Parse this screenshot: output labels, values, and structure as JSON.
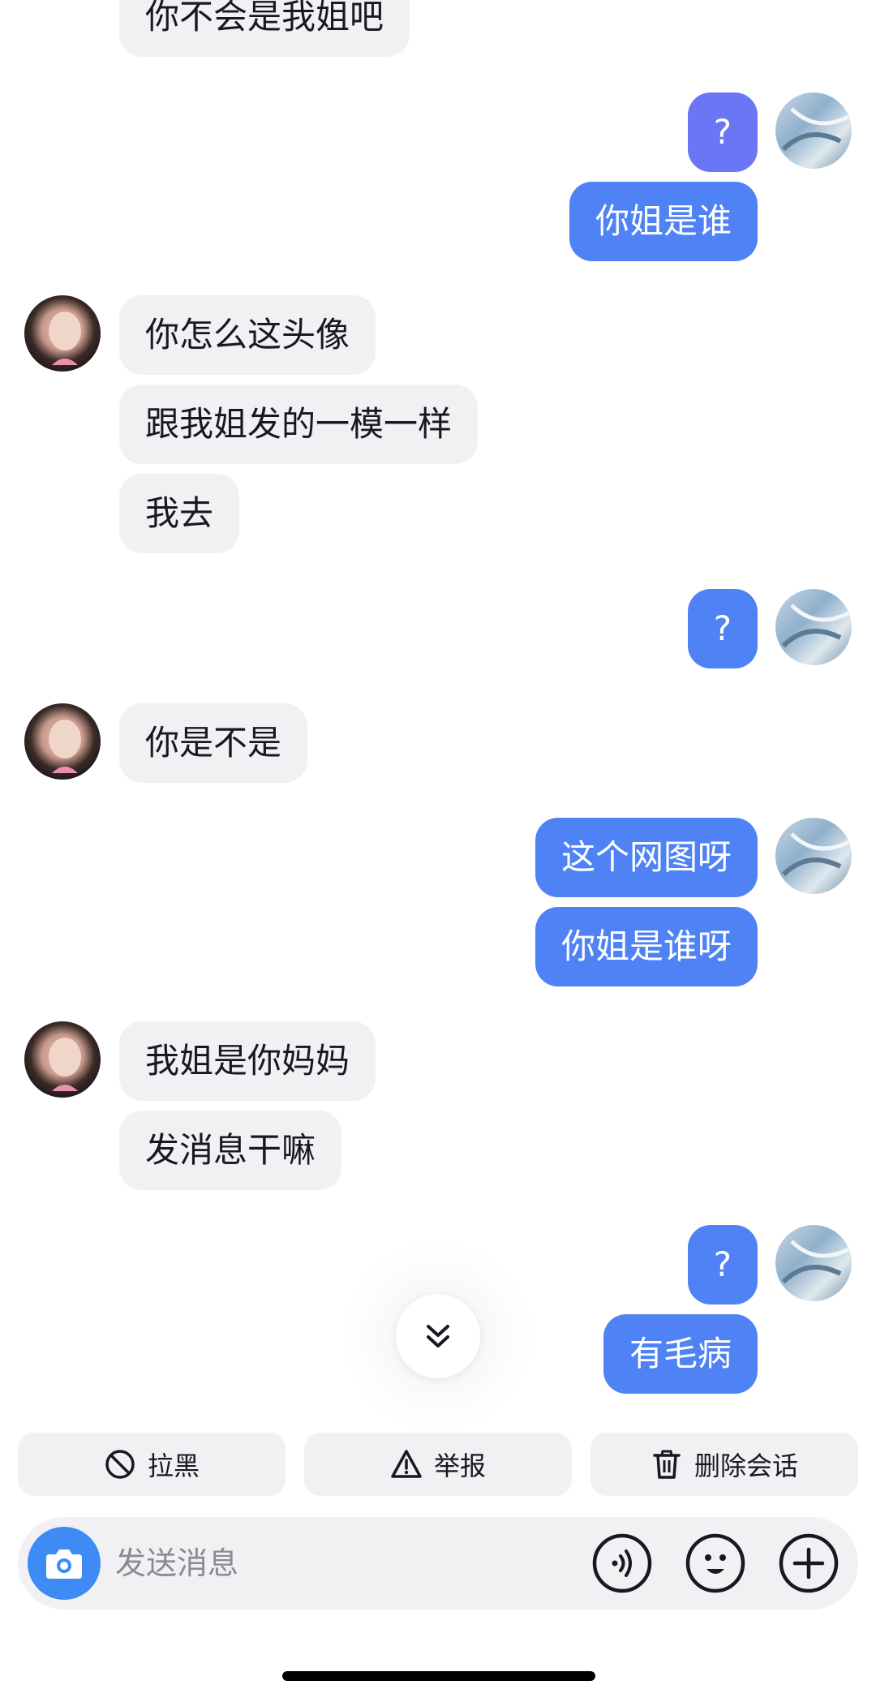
{
  "messages": [
    {
      "side": "in",
      "text": "你不会是我姐吧"
    },
    {
      "side": "out",
      "text": "?"
    },
    {
      "side": "out",
      "text": "你姐是谁"
    },
    {
      "side": "in",
      "text": "你怎么这头像"
    },
    {
      "side": "in",
      "text": "跟我姐发的一模一样"
    },
    {
      "side": "in",
      "text": "我去"
    },
    {
      "side": "out",
      "text": "?"
    },
    {
      "side": "in",
      "text": "你是不是"
    },
    {
      "side": "out",
      "text": "这个网图呀"
    },
    {
      "side": "out",
      "text": "你姐是谁呀"
    },
    {
      "side": "in",
      "text": "我姐是你妈妈"
    },
    {
      "side": "in",
      "text": "发消息干嘛"
    },
    {
      "side": "out",
      "text": "?"
    },
    {
      "side": "out",
      "text": "有毛病"
    }
  ],
  "actions": {
    "block": "拉黑",
    "report": "举报",
    "delete": "删除会话"
  },
  "composer": {
    "placeholder": "发送消息"
  },
  "colors": {
    "outgoing_bubble": "#4f83f5",
    "outgoing_bubble_first": "#6a76f3",
    "incoming_bubble": "#f1f1f3",
    "camera_button": "#3e8bf6"
  },
  "icons": [
    "camera-icon",
    "voice-icon",
    "emoji-icon",
    "plus-icon",
    "block-icon",
    "warning-icon",
    "trash-icon",
    "double-chevron-down-icon"
  ]
}
